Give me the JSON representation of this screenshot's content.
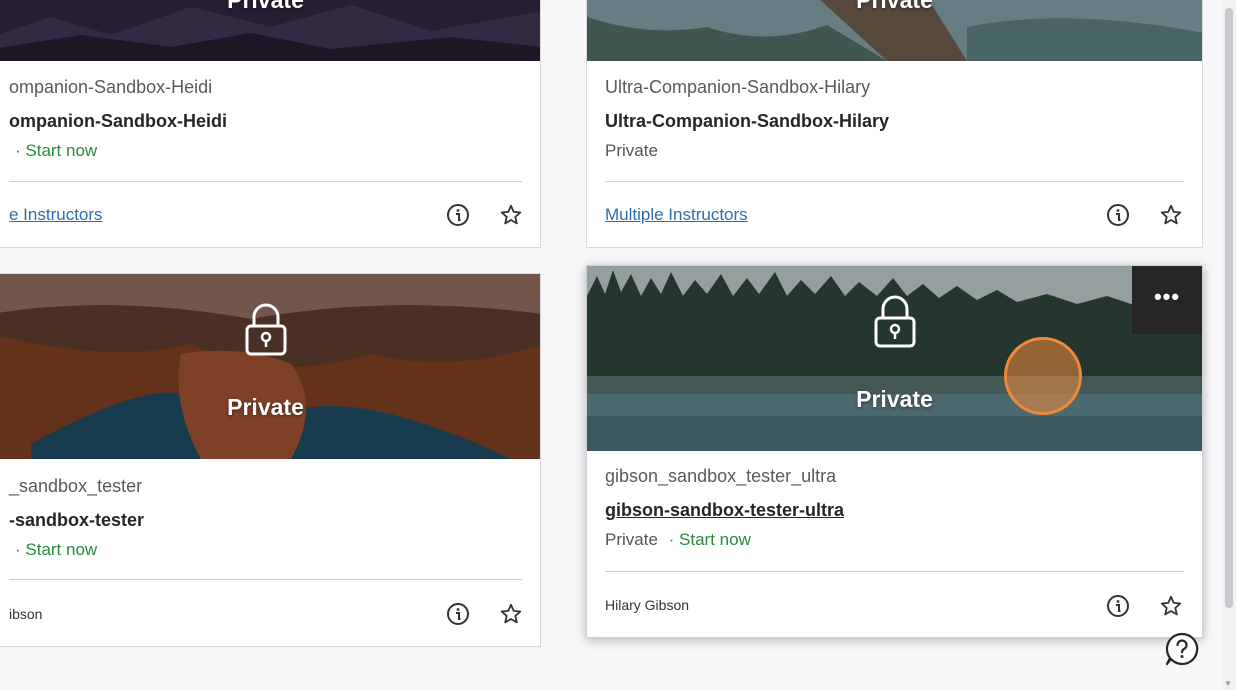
{
  "cards": [
    {
      "banner_label": "Private",
      "course_id": "ompanion-Sandbox-Heidi",
      "course_name": "ompanion-Sandbox-Heidi",
      "status": "",
      "start_label": "· Start now",
      "instructor": "e Instructors"
    },
    {
      "banner_label": "Private",
      "course_id": "Ultra-Companion-Sandbox-Hilary",
      "course_name": "Ultra-Companion-Sandbox-Hilary",
      "status": "Private",
      "start_label": "",
      "instructor": "Multiple Instructors"
    },
    {
      "banner_label": "Private",
      "course_id": "_sandbox_tester",
      "course_name": "-sandbox-tester",
      "status": "",
      "start_label": "· Start now",
      "instructor": "ibson"
    },
    {
      "banner_label": "Private",
      "course_id": "gibson_sandbox_tester_ultra",
      "course_name": "gibson-sandbox-tester-ultra",
      "status": "Private",
      "start_label": "· Start now",
      "instructor": "Hilary Gibson",
      "more_label": "•••"
    }
  ],
  "colors": {
    "link": "#2a6fb0",
    "start_now": "#2b8a3e",
    "cursor_ring": "#ef8a3a"
  },
  "icons": [
    "lock-icon",
    "info-icon",
    "star-icon",
    "more-icon",
    "help-icon"
  ]
}
